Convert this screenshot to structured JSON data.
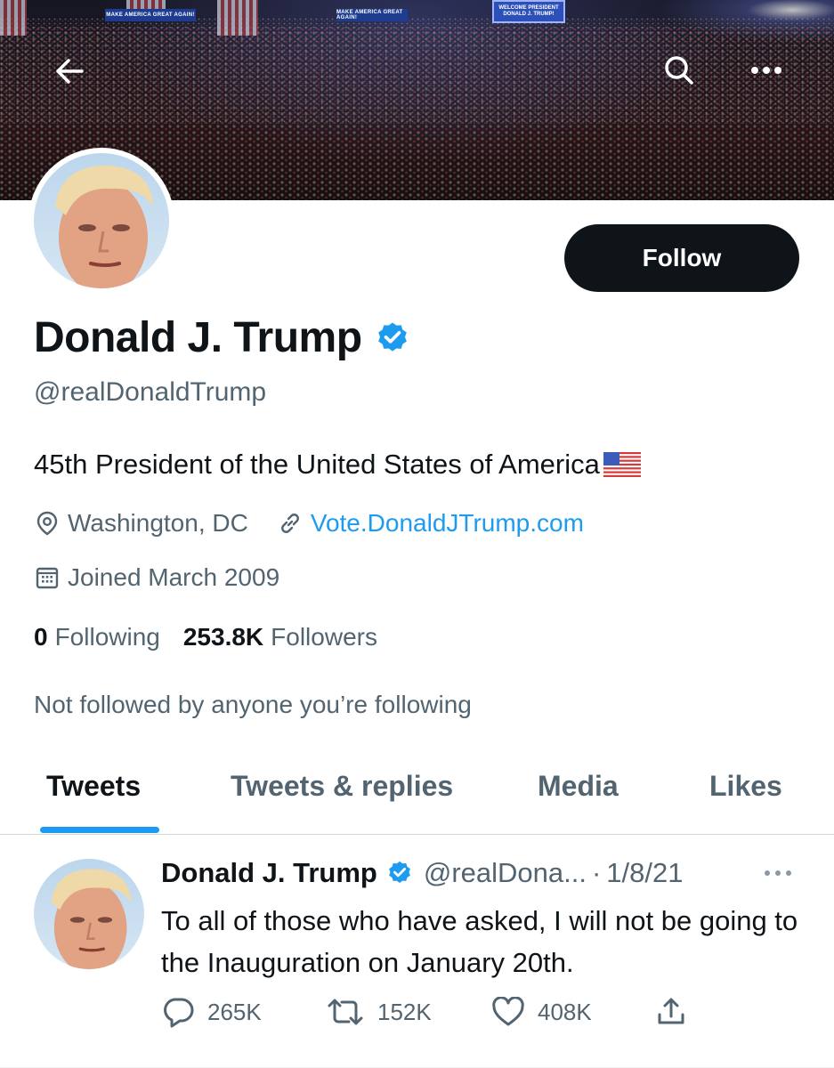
{
  "banner": {
    "sign_left": "MAKE AMERICA GREAT AGAIN!",
    "sign_right": "MAKE AMERICA GREAT AGAIN!",
    "screen_text": "WELCOME PRESIDENT DONALD J. TRUMP!"
  },
  "header": {
    "back_icon": "arrow-left-icon",
    "search_icon": "search-icon",
    "more_icon": "more-horizontal-icon"
  },
  "profile": {
    "follow_label": "Follow",
    "display_name": "Donald J. Trump",
    "handle": "@realDonaldTrump",
    "bio": "45th President of the United States of America",
    "location": "Washington, DC",
    "website": "Vote.DonaldJTrump.com",
    "joined": "Joined March 2009",
    "following_count": "0",
    "following_label": "Following",
    "followers_count": "253.8K",
    "followers_label": "Followers",
    "not_followed_text": "Not followed by anyone you’re following"
  },
  "tabs": [
    {
      "label": "Tweets",
      "active": true
    },
    {
      "label": "Tweets & replies",
      "active": false
    },
    {
      "label": "Media",
      "active": false
    },
    {
      "label": "Likes",
      "active": false
    }
  ],
  "tweet": {
    "name": "Donald J. Trump",
    "handle": "@realDona...",
    "separator": "·",
    "date": "1/8/21",
    "text": "To all of those who have asked, I will not be going to the Inauguration on January 20th.",
    "replies": "265K",
    "retweets": "152K",
    "likes": "408K"
  },
  "colors": {
    "accent": "#1d9bf0",
    "text_primary": "#0f1419",
    "text_secondary": "#536471",
    "follow_bg": "#0f1419"
  }
}
